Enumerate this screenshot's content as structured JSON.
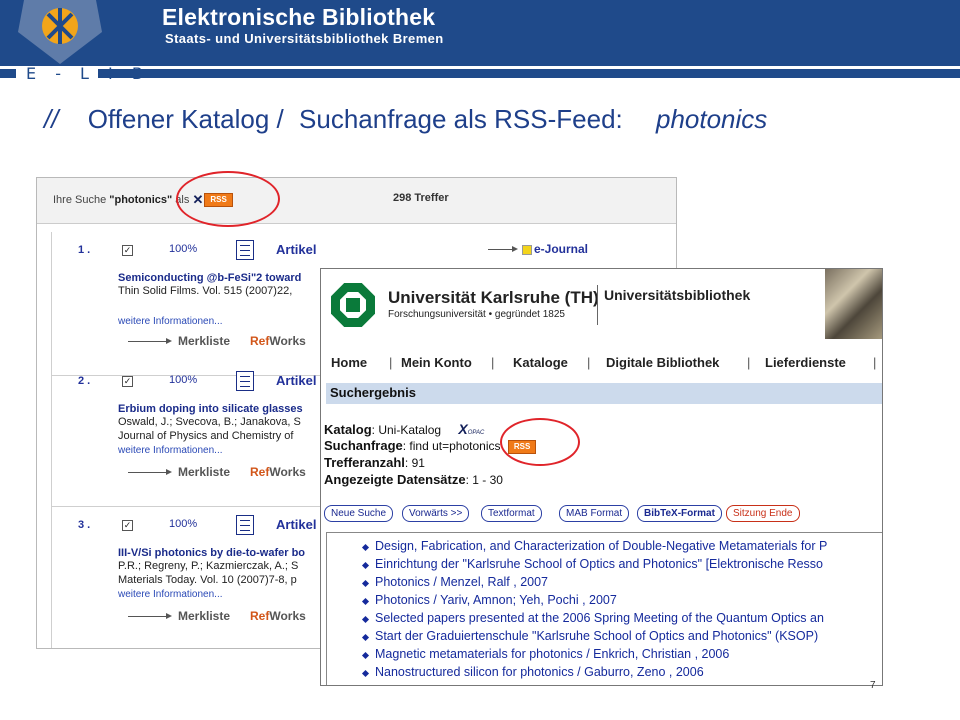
{
  "banner": {
    "title": "Elektronische Bibliothek",
    "subtitle": "Staats- und Universitätsbibliothek Bremen",
    "elib": "E - L I B"
  },
  "slide": {
    "slashes": "//",
    "title_part1": "Offener Katalog /",
    "title_part2": "Suchanfrage als RSS-Feed:",
    "keyword": "photonics"
  },
  "left_panel": {
    "query_prefix": "Ihre Suche ",
    "query_term": "\"photonics\"",
    "query_suffix": " als ",
    "rss_label": "RSS",
    "hits": "298 Treffer",
    "journal_link": "e-Journal",
    "results": [
      {
        "num": "1 .",
        "check": "✓",
        "pct": "100%",
        "type": "Artikel",
        "title": "Semiconducting @b-FeSi\"2 toward",
        "source1": "Thin Solid Films. Vol. 515 (2007)22,",
        "source2": "",
        "more": "weitere Informationen...",
        "merkliste": "Merkliste",
        "ref1": "Ref",
        "ref2": "Works"
      },
      {
        "num": "2 .",
        "check": "✓",
        "pct": "100%",
        "type": "Artikel",
        "title": "Erbium doping into silicate glasses",
        "source1": "Oswald, J.; Svecova, B.; Janakova, S",
        "source2": "Journal of Physics and Chemistry of",
        "more": "weitere Informationen...",
        "merkliste": "Merkliste",
        "ref1": "Ref",
        "ref2": "Works"
      },
      {
        "num": "3 .",
        "check": "✓",
        "pct": "100%",
        "type": "Artikel",
        "title": "III-V/Si photonics by die-to-wafer bo",
        "source1": "P.R.; Regreny, P.; Kazmierczak, A.; S",
        "source2": "Materials Today. Vol. 10 (2007)7-8, p",
        "more": "weitere Informationen...",
        "merkliste": "Merkliste",
        "ref1": "Ref",
        "ref2": "Works"
      }
    ]
  },
  "right_panel": {
    "uni_name": "Universität Karlsruhe (TH)",
    "uni_sub": "Forschungsuniversität • gegründet 1825",
    "ub": "Universitätsbibliothek",
    "nav": [
      "Home",
      "Mein Konto",
      "Kataloge",
      "Digitale Bibliothek",
      "Lieferdienste"
    ],
    "nav_sep": "|",
    "section_title": "Suchergebnis",
    "katalog_label": "Katalog",
    "katalog_value": ": Uni-Katalog",
    "xopac_x": "X",
    "xopac_opac": "OPAC",
    "query_label": "Suchanfrage",
    "query_value": ": find ut=photonics",
    "rss_label": "RSS",
    "hits_label": "Trefferanzahl",
    "hits_value": ": 91",
    "shown_label": "Angezeigte Datensätze",
    "shown_value": ": 1 - 30",
    "buttons": [
      "Neue Suche",
      "Vorwärts >>",
      "Textformat",
      "MAB Format",
      "BibTeX-Format",
      "Sitzung Ende"
    ],
    "items": [
      "Design, Fabrication, and Characterization of Double-Negative Metamaterials for P",
      "Einrichtung der \"Karlsruhe School of Optics and Photonics\" [Elektronische Resso",
      "Photonics / Menzel, Ralf , 2007",
      "Photonics / Yariv, Amnon; Yeh, Pochi , 2007",
      "Selected papers presented at the 2006 Spring Meeting of the Quantum Optics an",
      "Start der Graduiertenschule \"Karlsruhe School of Optics and Photonics\" (KSOP)",
      "Magnetic metamaterials for photonics / Enkrich, Christian , 2006",
      "Nanostructured silicon for photonics / Gaburro, Zeno , 2006"
    ]
  },
  "page_number": "7"
}
